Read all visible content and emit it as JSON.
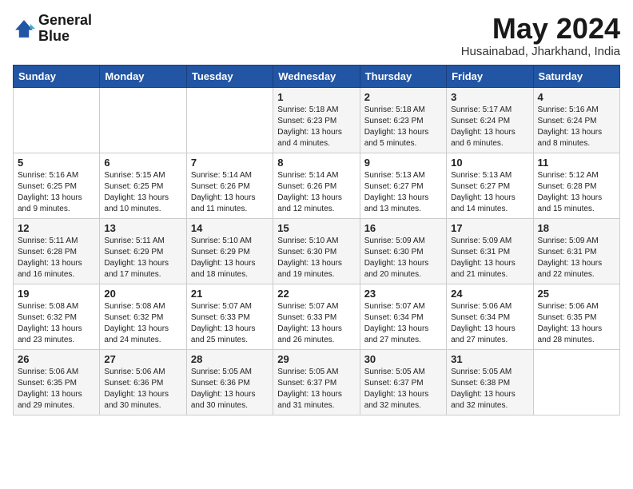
{
  "logo": {
    "line1": "General",
    "line2": "Blue"
  },
  "title": "May 2024",
  "subtitle": "Husainabad, Jharkhand, India",
  "days_of_week": [
    "Sunday",
    "Monday",
    "Tuesday",
    "Wednesday",
    "Thursday",
    "Friday",
    "Saturday"
  ],
  "weeks": [
    [
      {
        "day": null,
        "info": null
      },
      {
        "day": null,
        "info": null
      },
      {
        "day": null,
        "info": null
      },
      {
        "day": "1",
        "info": "Sunrise: 5:18 AM\nSunset: 6:23 PM\nDaylight: 13 hours\nand 4 minutes."
      },
      {
        "day": "2",
        "info": "Sunrise: 5:18 AM\nSunset: 6:23 PM\nDaylight: 13 hours\nand 5 minutes."
      },
      {
        "day": "3",
        "info": "Sunrise: 5:17 AM\nSunset: 6:24 PM\nDaylight: 13 hours\nand 6 minutes."
      },
      {
        "day": "4",
        "info": "Sunrise: 5:16 AM\nSunset: 6:24 PM\nDaylight: 13 hours\nand 8 minutes."
      }
    ],
    [
      {
        "day": "5",
        "info": "Sunrise: 5:16 AM\nSunset: 6:25 PM\nDaylight: 13 hours\nand 9 minutes."
      },
      {
        "day": "6",
        "info": "Sunrise: 5:15 AM\nSunset: 6:25 PM\nDaylight: 13 hours\nand 10 minutes."
      },
      {
        "day": "7",
        "info": "Sunrise: 5:14 AM\nSunset: 6:26 PM\nDaylight: 13 hours\nand 11 minutes."
      },
      {
        "day": "8",
        "info": "Sunrise: 5:14 AM\nSunset: 6:26 PM\nDaylight: 13 hours\nand 12 minutes."
      },
      {
        "day": "9",
        "info": "Sunrise: 5:13 AM\nSunset: 6:27 PM\nDaylight: 13 hours\nand 13 minutes."
      },
      {
        "day": "10",
        "info": "Sunrise: 5:13 AM\nSunset: 6:27 PM\nDaylight: 13 hours\nand 14 minutes."
      },
      {
        "day": "11",
        "info": "Sunrise: 5:12 AM\nSunset: 6:28 PM\nDaylight: 13 hours\nand 15 minutes."
      }
    ],
    [
      {
        "day": "12",
        "info": "Sunrise: 5:11 AM\nSunset: 6:28 PM\nDaylight: 13 hours\nand 16 minutes."
      },
      {
        "day": "13",
        "info": "Sunrise: 5:11 AM\nSunset: 6:29 PM\nDaylight: 13 hours\nand 17 minutes."
      },
      {
        "day": "14",
        "info": "Sunrise: 5:10 AM\nSunset: 6:29 PM\nDaylight: 13 hours\nand 18 minutes."
      },
      {
        "day": "15",
        "info": "Sunrise: 5:10 AM\nSunset: 6:30 PM\nDaylight: 13 hours\nand 19 minutes."
      },
      {
        "day": "16",
        "info": "Sunrise: 5:09 AM\nSunset: 6:30 PM\nDaylight: 13 hours\nand 20 minutes."
      },
      {
        "day": "17",
        "info": "Sunrise: 5:09 AM\nSunset: 6:31 PM\nDaylight: 13 hours\nand 21 minutes."
      },
      {
        "day": "18",
        "info": "Sunrise: 5:09 AM\nSunset: 6:31 PM\nDaylight: 13 hours\nand 22 minutes."
      }
    ],
    [
      {
        "day": "19",
        "info": "Sunrise: 5:08 AM\nSunset: 6:32 PM\nDaylight: 13 hours\nand 23 minutes."
      },
      {
        "day": "20",
        "info": "Sunrise: 5:08 AM\nSunset: 6:32 PM\nDaylight: 13 hours\nand 24 minutes."
      },
      {
        "day": "21",
        "info": "Sunrise: 5:07 AM\nSunset: 6:33 PM\nDaylight: 13 hours\nand 25 minutes."
      },
      {
        "day": "22",
        "info": "Sunrise: 5:07 AM\nSunset: 6:33 PM\nDaylight: 13 hours\nand 26 minutes."
      },
      {
        "day": "23",
        "info": "Sunrise: 5:07 AM\nSunset: 6:34 PM\nDaylight: 13 hours\nand 27 minutes."
      },
      {
        "day": "24",
        "info": "Sunrise: 5:06 AM\nSunset: 6:34 PM\nDaylight: 13 hours\nand 27 minutes."
      },
      {
        "day": "25",
        "info": "Sunrise: 5:06 AM\nSunset: 6:35 PM\nDaylight: 13 hours\nand 28 minutes."
      }
    ],
    [
      {
        "day": "26",
        "info": "Sunrise: 5:06 AM\nSunset: 6:35 PM\nDaylight: 13 hours\nand 29 minutes."
      },
      {
        "day": "27",
        "info": "Sunrise: 5:06 AM\nSunset: 6:36 PM\nDaylight: 13 hours\nand 30 minutes."
      },
      {
        "day": "28",
        "info": "Sunrise: 5:05 AM\nSunset: 6:36 PM\nDaylight: 13 hours\nand 30 minutes."
      },
      {
        "day": "29",
        "info": "Sunrise: 5:05 AM\nSunset: 6:37 PM\nDaylight: 13 hours\nand 31 minutes."
      },
      {
        "day": "30",
        "info": "Sunrise: 5:05 AM\nSunset: 6:37 PM\nDaylight: 13 hours\nand 32 minutes."
      },
      {
        "day": "31",
        "info": "Sunrise: 5:05 AM\nSunset: 6:38 PM\nDaylight: 13 hours\nand 32 minutes."
      },
      {
        "day": null,
        "info": null
      }
    ]
  ]
}
